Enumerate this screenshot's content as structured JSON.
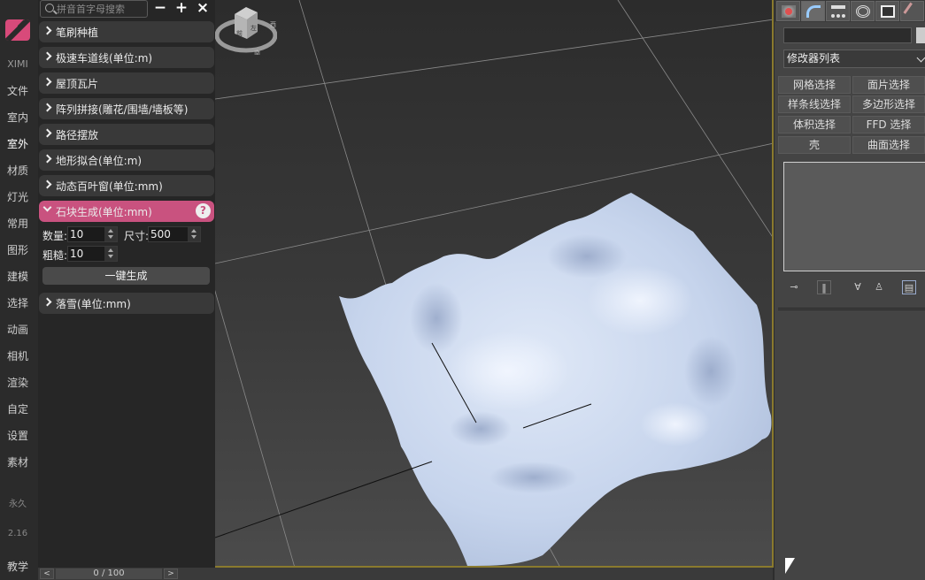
{
  "leftnav": {
    "brand": "XIMI",
    "items": [
      "文件",
      "室内",
      "室外",
      "材质",
      "灯光",
      "常用",
      "图形",
      "建模",
      "选择",
      "动画",
      "相机",
      "渲染",
      "自定",
      "设置",
      "素材"
    ],
    "active": "室外",
    "permanent": "永久",
    "version": "2.16",
    "teach": "教学"
  },
  "panel": {
    "search_placeholder": "拼音首字母搜索",
    "minus": "−",
    "plus": "+",
    "close": "×",
    "categories_top": [
      "笔刷种植",
      "极速车道线(单位:m)",
      "屋顶瓦片",
      "阵列拼接(雕花/围墙/墙板等)",
      "路径摆放",
      "地形拟合(单位:m)",
      "动态百叶窗(单位:mm)"
    ],
    "open_category": "石块生成(单位:mm)",
    "help": "?",
    "count_label": "数量:",
    "count_value": "10",
    "size_label": "尺寸:",
    "size_value": "500",
    "rough_label": "粗糙:",
    "rough_value": "10",
    "generate_button": "一键生成",
    "category_after": "落雪(单位:mm)"
  },
  "timeline": {
    "prev": "<",
    "frame": "0 / 100",
    "next": ">"
  },
  "viewcube": {
    "labels": [
      "前",
      "左",
      "南",
      "西"
    ]
  },
  "cmdpanel": {
    "tabs": [
      "create-icon",
      "modify-icon",
      "hierarchy-icon",
      "motion-icon",
      "display-icon",
      "utilities-icon"
    ],
    "modifier_list": "修改器列表",
    "buttons": [
      "网格选择",
      "面片选择",
      "样条线选择",
      "多边形选择",
      "体积选择",
      "FFD 选择",
      "壳",
      "曲面选择"
    ]
  },
  "colors": {
    "accent": "#c9527f",
    "terrain": "#c8d6ee",
    "viewport_border": "#8a7a2e"
  }
}
